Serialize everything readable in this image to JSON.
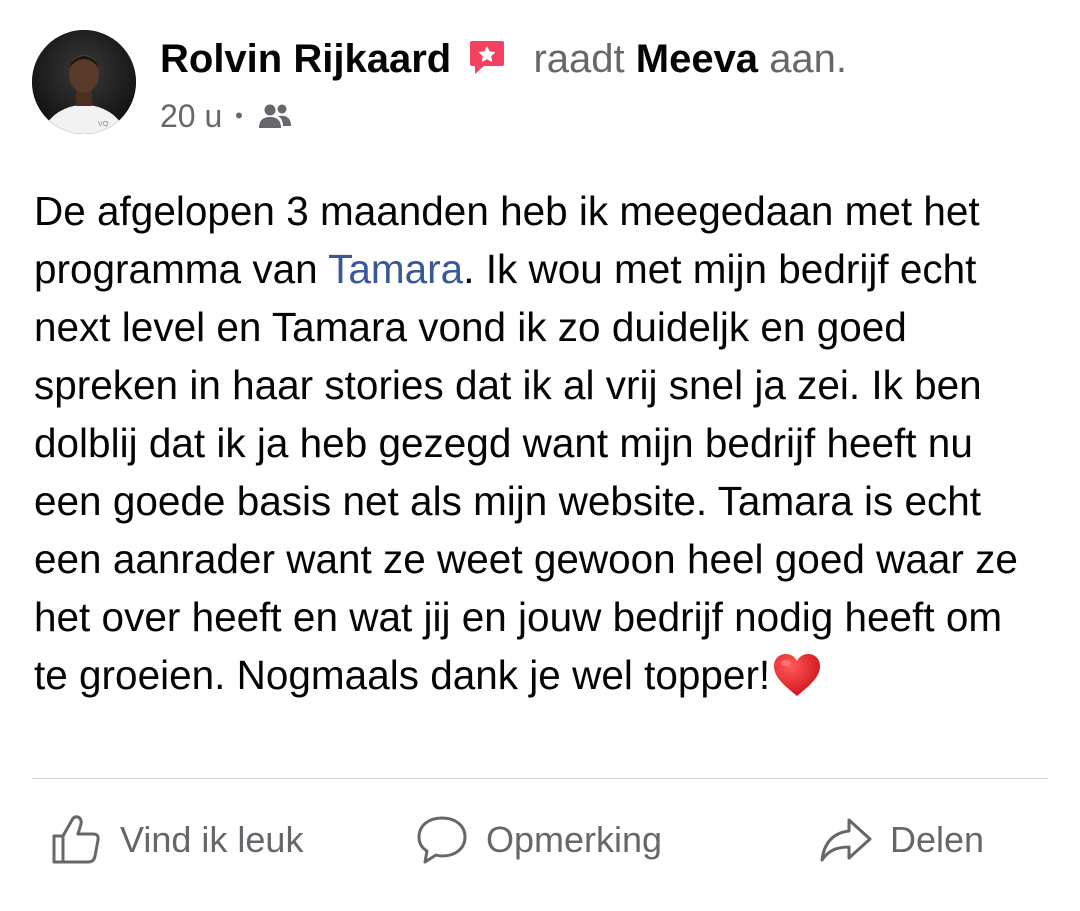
{
  "post": {
    "author": "Rolvin Rijkaard",
    "verb": "raadt",
    "page": "Meeva",
    "verb_suffix": "aan.",
    "time": "20 u",
    "separator": "•",
    "audience_icon": "friends-icon",
    "badge_icon": "recommendation-badge-icon",
    "body": {
      "part1": "De afgelopen 3 maanden heb ik meegedaan met het programma van ",
      "mention": "Tamara",
      "part2": ". Ik wou met mijn bedrijf echt next level en Tamara vond ik zo duideljk en goed spreken in haar stories dat ik al vrij snel ja zei. Ik ben dolblij dat ik ja heb gezegd want mijn bedrijf heeft nu een goede basis net als mijn website. Tamara is echt een aanrader want ze weet gewoon heel goed waar ze het over heeft en wat jij en jouw bedrijf nodig heeft om te groeien. Nogmaals dank je wel topper!",
      "emoji_icon": "red-heart-icon"
    }
  },
  "actions": {
    "like": "Vind ik leuk",
    "comment": "Opmerking",
    "share": "Delen"
  },
  "colors": {
    "text": "#050505",
    "secondary": "#65676b",
    "mention": "#385898",
    "badge": "#f3425f",
    "divider": "#ced0d4"
  }
}
